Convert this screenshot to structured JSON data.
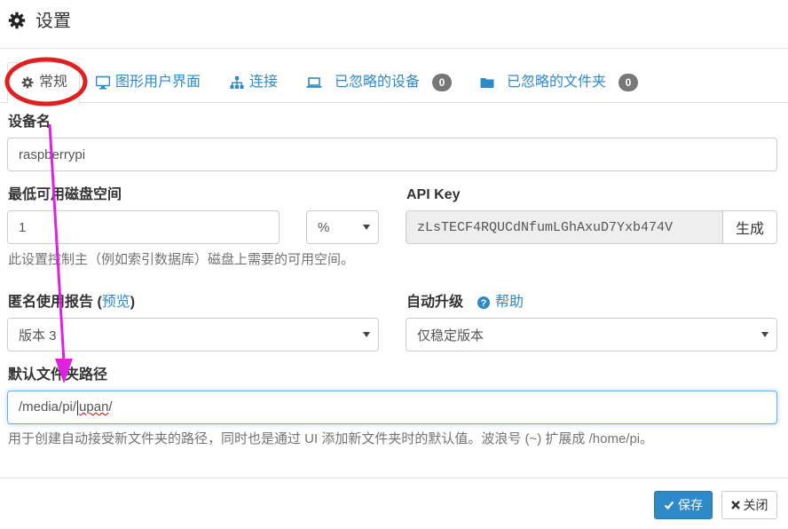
{
  "header": {
    "title": "设置",
    "icon": "gear-icon"
  },
  "tabs": [
    {
      "label": "常规",
      "icon": "gear-icon",
      "active": true
    },
    {
      "label": "图形用户界面",
      "icon": "monitor-icon"
    },
    {
      "label": "连接",
      "icon": "sitemap-icon"
    },
    {
      "label": "已忽略的设备",
      "icon": "laptop-icon",
      "badge": "0"
    },
    {
      "label": "已忽略的文件夹",
      "icon": "folder-icon",
      "badge": "0"
    }
  ],
  "device_name": {
    "label": "设备名",
    "value": "raspberrypi"
  },
  "min_disk": {
    "label": "最低可用磁盘空间",
    "value": "1",
    "unit": "%",
    "help": "此设置控制主（例如索引数据库）磁盘上需要的可用空间。"
  },
  "api_key": {
    "label": "API Key",
    "value": "zLsTECF4RQUCdNfumLGhAxuD7Yxb474V",
    "generate_label": "生成"
  },
  "usage_report": {
    "label_prefix": "匿名使用报告 (",
    "preview_link": "预览",
    "label_suffix": ")",
    "value": "版本 3"
  },
  "auto_upgrade": {
    "label": "自动升级",
    "help_link": "帮助",
    "value": "仅稳定版本"
  },
  "default_folder": {
    "label": "默认文件夹路径",
    "value_prefix": "/media/pi/",
    "value_misspelled": "upan",
    "value_suffix": "/",
    "help": "用于创建自动接受新文件夹的路径，同时也是通过 UI 添加新文件夹时的默认值。波浪号 (~) 扩展成 /home/pi。"
  },
  "footer": {
    "save_label": "保存",
    "close_label": "关闭"
  },
  "colors": {
    "accent": "#2e89c9",
    "annotation_circle": "#e02020",
    "annotation_arrow": "#e020e0"
  }
}
